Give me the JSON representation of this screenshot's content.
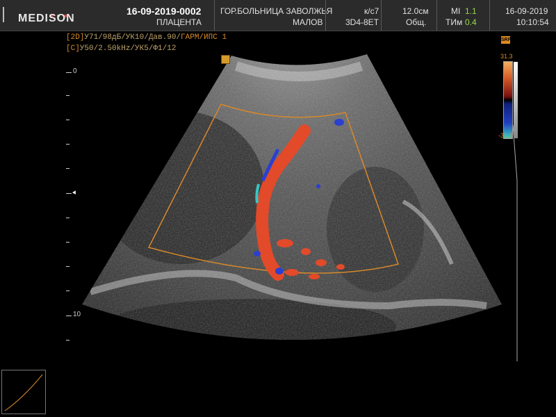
{
  "header": {
    "brand": "MEDISON",
    "patient_id": "16-09-2019-0002",
    "exam_type": "ПЛАЦЕНТА",
    "hospital": "ГОР.БОЛЬНИЦА ЗАВОЛЖЬЯ",
    "doctor": "МАЛОВ",
    "preset": "к/с7",
    "probe": "3D4-8ET",
    "depth": "12.0см",
    "app": "Общ.",
    "mi_label": "MI",
    "mi_value": "1.1",
    "tim_label": "ТИм",
    "tim_value": "0.4",
    "date": "16-09-2019",
    "time": "10:10:54"
  },
  "params": {
    "line1_tag": "[2D]",
    "line1_text": "У71/98дБ/УК10/Дав.90/",
    "line1_extra": "ГАРМ/ИПС 1",
    "line2_tag": "[C]",
    "line2_text": "У50/2.50kHz/УК5/Ф1/12"
  },
  "ruler": {
    "labels": [
      "0",
      "10"
    ]
  },
  "color_scale": {
    "max": "31.3",
    "min": "-31.3",
    "badge": "SRF"
  },
  "colors": {
    "header_bg": "#2b2b2b",
    "accent_orange": "#d8892a",
    "doppler_red": "#e24a2a",
    "doppler_blue": "#2b3fd0",
    "text_green": "#9ad84a"
  }
}
